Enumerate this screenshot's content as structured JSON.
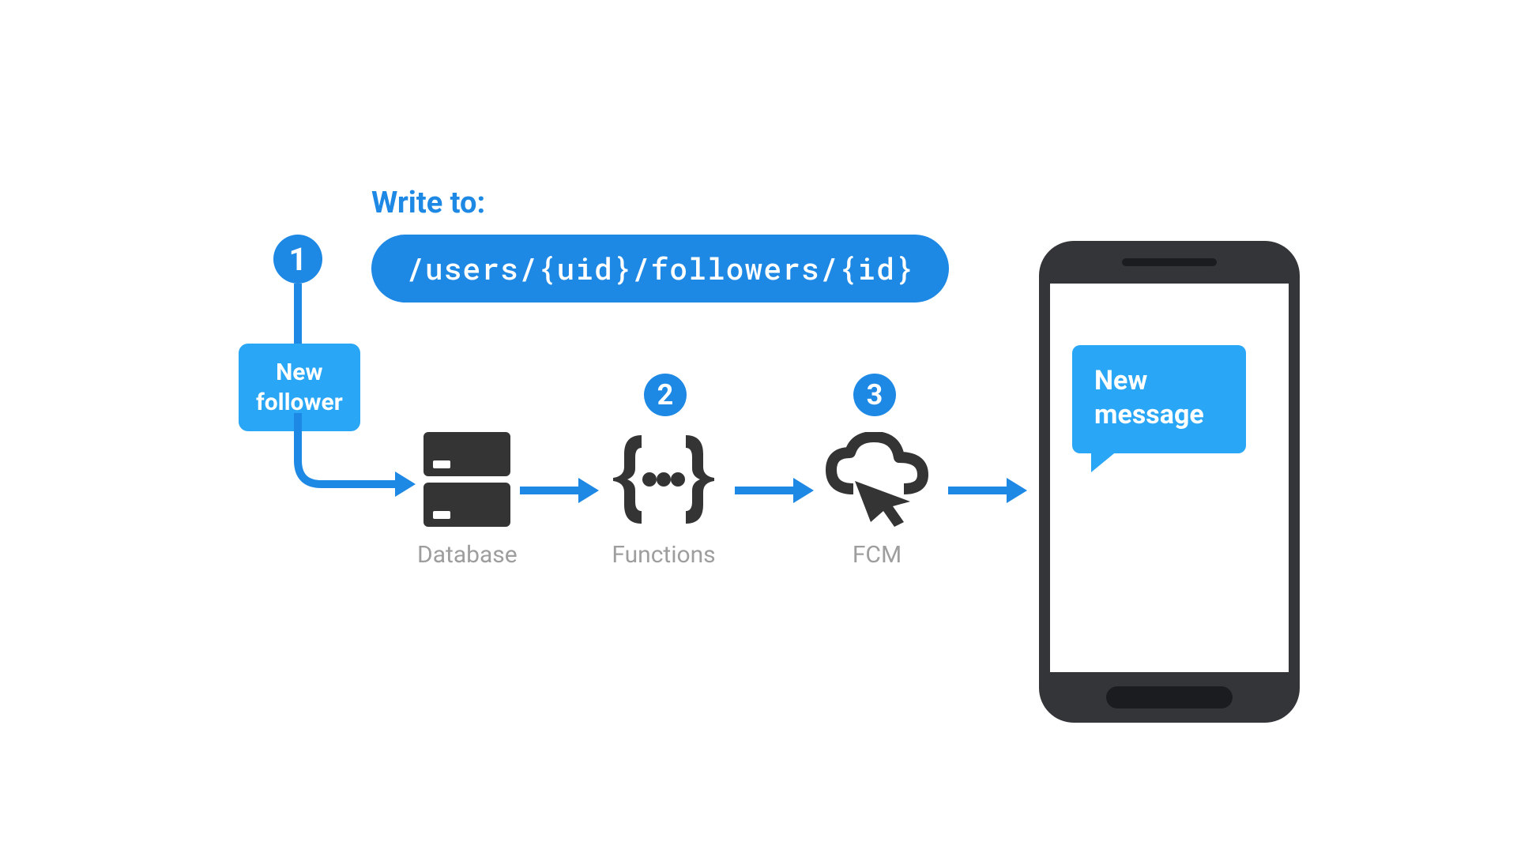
{
  "header": {
    "write_label": "Write to:",
    "path": "/users/{uid}/followers/{id}"
  },
  "badges": {
    "one": "1",
    "two": "2",
    "three": "3"
  },
  "trigger": {
    "line1": "New",
    "line2": "follower"
  },
  "services": {
    "database": "Database",
    "functions": "Functions",
    "fcm": "FCM"
  },
  "phone": {
    "bubble_line1": "New",
    "bubble_line2": "message"
  },
  "colors": {
    "accent": "#1E88E5",
    "light_accent": "#29A6F5",
    "icon_dark": "#343434",
    "label_grey": "#9E9E9E"
  }
}
